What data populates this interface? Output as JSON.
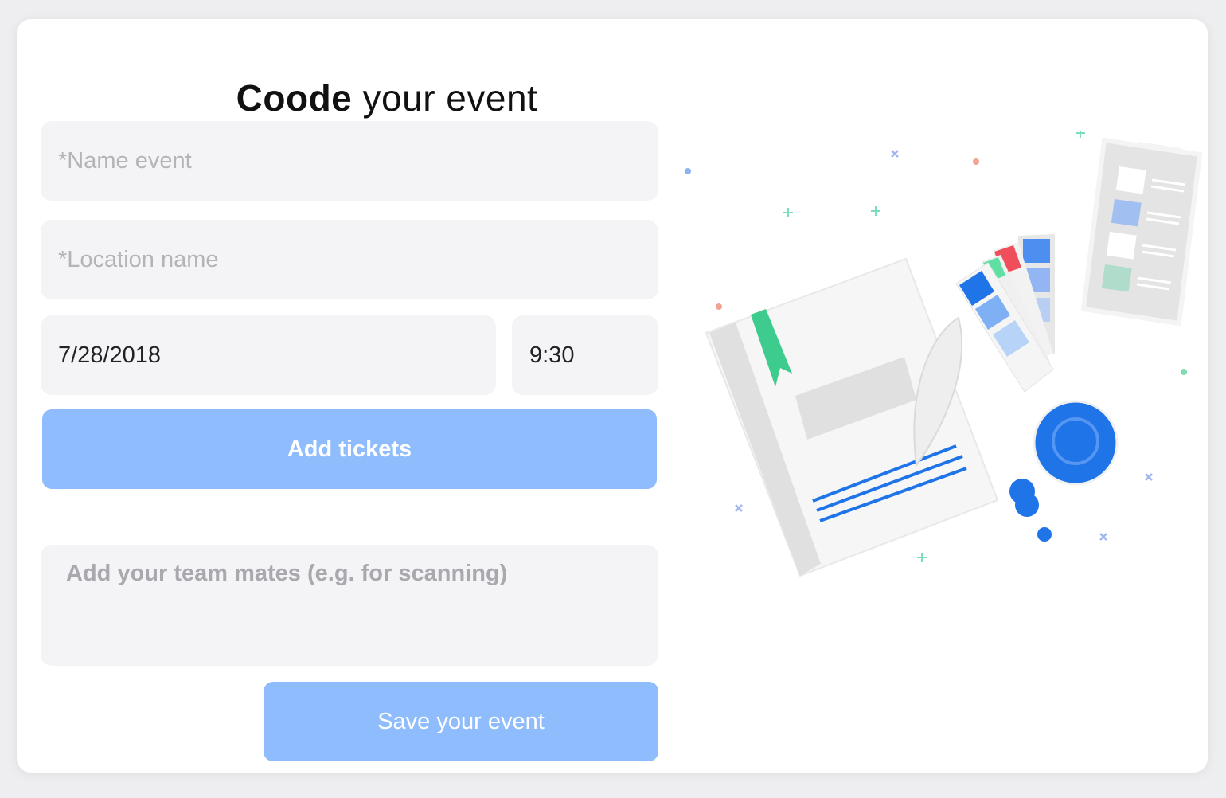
{
  "header": {
    "brand": "Coode",
    "rest": " your event"
  },
  "form": {
    "name_placeholder": "*Name event",
    "location_placeholder": "*Location name",
    "date_value": "7/28/2018",
    "time_value": "9:30",
    "add_tickets_label": "Add tickets",
    "team_placeholder": "Add your team mates (e.g. for scanning)",
    "save_label": "Save your event"
  },
  "colors": {
    "accent": "#8fbcfc",
    "field_bg": "#f4f4f6",
    "illustration_blue": "#1f74e8",
    "illustration_green": "#3dcc8e"
  },
  "illustration": {
    "name": "notebook-and-color-swatches-illustration"
  }
}
